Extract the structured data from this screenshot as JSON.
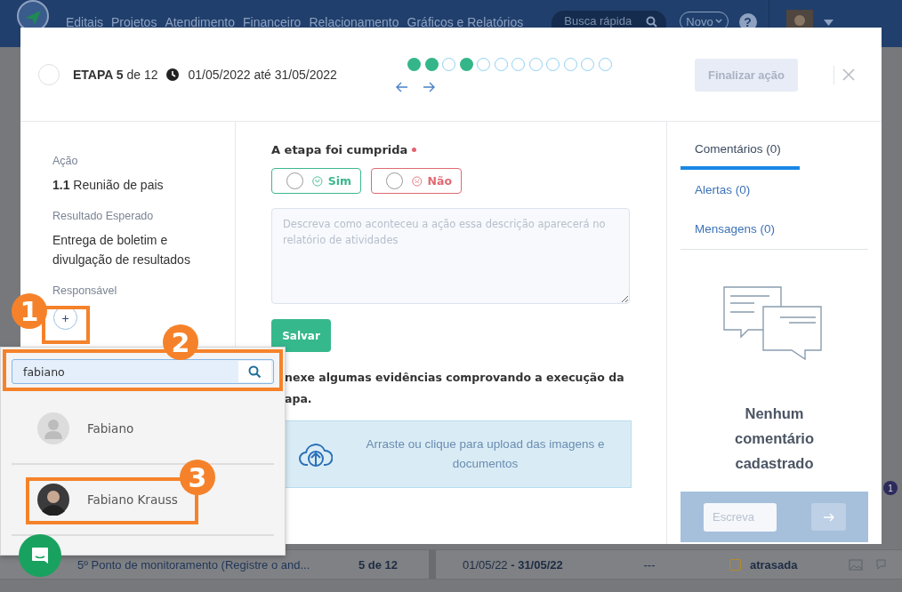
{
  "nav": {
    "menu": [
      {
        "label": "Editais"
      },
      {
        "label": "Projetos"
      },
      {
        "label": "Atendimento"
      },
      {
        "label": "Financeiro"
      },
      {
        "label": "Relacionamento"
      },
      {
        "label": "Gráficos e Relatórios"
      }
    ],
    "search_placeholder": "Busca rápida",
    "new_button": "Novo",
    "help": "?"
  },
  "modal": {
    "step": {
      "title": "ETAPA 5",
      "count": "de 12",
      "dates": "01/05/2022 até 31/05/2022"
    },
    "steps": [
      {
        "done": true
      },
      {
        "done": true
      },
      {
        "done": false
      },
      {
        "done": true
      },
      {
        "done": false
      },
      {
        "done": false
      },
      {
        "done": false
      },
      {
        "done": false
      },
      {
        "done": false
      },
      {
        "done": false
      },
      {
        "done": false
      },
      {
        "done": false
      }
    ],
    "finish_button": {
      "label": "Finalizar ação",
      "disabled": true
    },
    "action": {
      "label": "Ação",
      "value": "**1.1** Reunião de pais"
    },
    "expected": {
      "label": "Resultado Esperado",
      "value": "Entrega de boletim e divulgação de resultados"
    },
    "responsible": {
      "label": "Responsável",
      "add_button": "+"
    },
    "form": {
      "question": "A etapa foi cumprida",
      "required": true,
      "options": [
        {
          "kind": "yes",
          "label": "Sim",
          "selected": false
        },
        {
          "kind": "no",
          "label": "Não",
          "selected": false
        }
      ],
      "description_placeholder": "Descreva como aconteceu a ação essa descrição aparecerá no relatório de atividades",
      "save_button": "Salvar",
      "evidence_lines": [
        "nexe algumas evidências comprovando a execução da",
        "apa."
      ],
      "upload_text": "Arraste ou clique para upload das imagens e documentos"
    },
    "side": {
      "tabs": [
        {
          "label": "Comentários (0)",
          "selected": true
        },
        {
          "label": "Alertas (0)",
          "selected": false
        },
        {
          "label": "Mensagens (0)",
          "selected": false
        }
      ],
      "empty_text": "Nenhum comentário cadastrado",
      "comment_placeholder": "Escreva"
    }
  },
  "popup": {
    "search_value": "fabiano",
    "results": [
      {
        "name": "Fabiano",
        "kind": "placeholder"
      },
      {
        "name": "Fabiano Krauss",
        "kind": "photo"
      }
    ]
  },
  "annotations": [
    {
      "label": "1"
    },
    {
      "label": "2"
    },
    {
      "label": "3"
    }
  ],
  "table_row": {
    "title": "5º Ponto de monitoramento (Registre o and...",
    "step": "5 de 12",
    "period": "01/05/22 **- 31/05/22**",
    "column_4": "---",
    "status": {
      "label": "atrasada",
      "color": "#b58a2a"
    }
  },
  "side_badge": "1"
}
